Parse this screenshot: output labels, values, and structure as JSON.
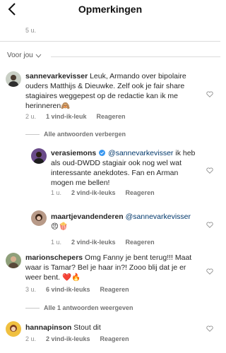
{
  "header": {
    "title": "Opmerkingen"
  },
  "prev_comment": {
    "time": "5 u."
  },
  "sort": {
    "label": "Voor jou"
  },
  "comments": [
    {
      "user": "sannevarkevisser",
      "text": "Leuk, Armando over bipolaire ouders Matthijs & Dieuwke. Zelf ook je fair share stagiaires weggepest op de redactie kan ik me herinneren🙈",
      "time": "2 u.",
      "likes": "1 vind-ik-leuk",
      "reply": "Reageren"
    },
    {
      "user": "marionschepers",
      "text": "Omg Fanny je bent terug!!! Maat waar is Tamar? Bel je haar in?! Zooo blij dat je er weer bent. ❤️🔥",
      "time": "3 u.",
      "likes": "6 vind-ik-leuks",
      "reply": "Reageren"
    },
    {
      "user": "hannapinson",
      "text": "Stout dit",
      "time": "2 u.",
      "likes": "2 vind-ik-leuks",
      "reply": "Reageren"
    }
  ],
  "thread_hide": "Alle antwoorden verbergen",
  "replies": [
    {
      "user": "verasiemons",
      "mention": "@sannevarkevisser",
      "text": " ik heb als oud-DWDD stagiair ook nog wel wat interessante anekdotes. Fan en Arman mogen me bellen!",
      "time": "1 u.",
      "likes": "2 vind-ik-leuks",
      "reply": "Reageren"
    },
    {
      "user": "maartjevandenderen",
      "mention": "@sannevarkevisser",
      "text": "😠🍿",
      "time": "1 u.",
      "likes": "2 vind-ik-leuks",
      "reply": "Reageren"
    }
  ],
  "thread_show": "Alle 1 antwoorden weergeven",
  "colors": {
    "mention": "#00376b",
    "verified": "#3897f0",
    "meta": "#8e8e8e"
  }
}
